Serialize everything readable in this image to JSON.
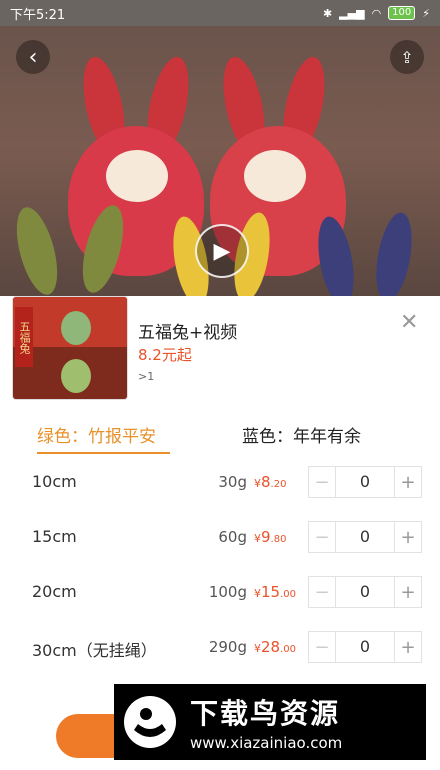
{
  "status_bar": {
    "time": "下午5:21",
    "battery": "100"
  },
  "hero": {
    "back_icon": "chevron-left-icon",
    "share_icon": "share-icon",
    "play_icon": "play-icon"
  },
  "product": {
    "thumb_label": "五福兔",
    "name": "五福兔+视频",
    "price": "8.2元起",
    "min_order": ">1",
    "close_icon": "close-icon"
  },
  "tabs": [
    {
      "label": "绿色：竹报平安",
      "active": true
    },
    {
      "label": "蓝色：年年有余",
      "active": false
    }
  ],
  "variants": [
    {
      "size": "10cm",
      "weight": "30g",
      "yen": "¥",
      "price_int": "8",
      "price_dec": ".20",
      "qty": "0"
    },
    {
      "size": "15cm",
      "weight": "60g",
      "yen": "¥",
      "price_int": "9",
      "price_dec": ".80",
      "qty": "0"
    },
    {
      "size": "20cm",
      "weight": "100g",
      "yen": "¥",
      "price_int": "15",
      "price_dec": ".00",
      "qty": "0"
    },
    {
      "size": "30cm（无挂绳）",
      "weight": "290g",
      "yen": "¥",
      "price_int": "28",
      "price_dec": ".00",
      "qty": "0"
    }
  ],
  "stepper": {
    "minus": "−",
    "plus": "+"
  },
  "watermark": {
    "title": "下载鸟资源",
    "url": "www.xiazainiao.com"
  },
  "colors": {
    "accent": "#e8912b",
    "price": "#e8532b",
    "button": "#ef7a28"
  }
}
